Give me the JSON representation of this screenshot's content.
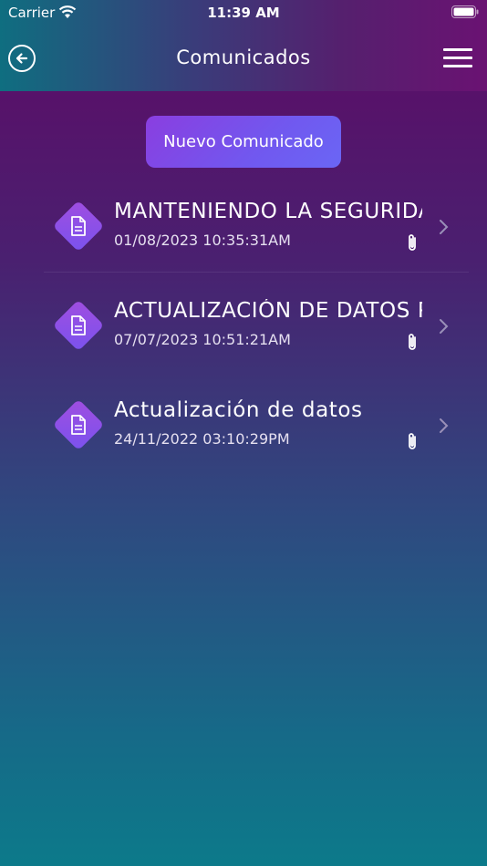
{
  "status_bar": {
    "carrier": "Carrier",
    "time": "11:39 AM"
  },
  "header": {
    "title": "Comunicados"
  },
  "actions": {
    "new_label": "Nuevo Comunicado"
  },
  "items": [
    {
      "title": "MANTENIENDO LA SEGURIDAD",
      "date": "01/08/2023 10:35:31AM"
    },
    {
      "title": "ACTUALIZACIÓN DE DATOS PERSONALES",
      "date": "07/07/2023 10:51:21AM"
    },
    {
      "title": "Actualización de datos",
      "date": "24/11/2022 03:10:29PM"
    }
  ],
  "icons": {
    "back": "back-arrow-icon",
    "menu": "hamburger-menu-icon",
    "document": "document-icon",
    "attachment": "paperclip-icon",
    "chevron": "chevron-right-icon"
  },
  "colors": {
    "button": "#7a4ee8",
    "diamond": "#8a50e8"
  }
}
